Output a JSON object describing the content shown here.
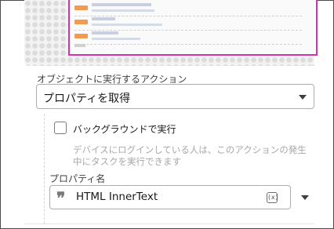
{
  "preview": {
    "rows": [
      {
        "line1_width": 76,
        "line2_width": 80
      },
      {
        "line1_width": 30,
        "line2_width": 90
      },
      {
        "line1_width": 34,
        "line2_width": 62
      }
    ]
  },
  "action": {
    "section_label": "オブジェクトに実行するアクション",
    "selected_value": "プロパティを取得"
  },
  "background": {
    "checked": false,
    "label": "バックグラウンドで実行",
    "help_text": "デバイスにログインしている人は、このアクションの発生中にタスクを実行できます"
  },
  "property": {
    "label": "プロパティ名",
    "value": "HTML InnerText",
    "variable_icon": "(x)"
  },
  "icons": {
    "value_type": "quote-icon",
    "variable": "variable-icon",
    "dropdown": "chevron-down-icon"
  }
}
